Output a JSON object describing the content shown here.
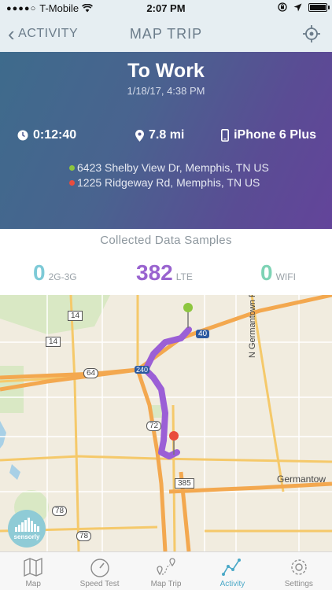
{
  "status_bar": {
    "carrier": "T-Mobile",
    "time": "2:07 PM"
  },
  "nav": {
    "back_label": "ACTIVITY",
    "title": "MAP TRIP"
  },
  "trip": {
    "name": "To Work",
    "date": "1/18/17, 4:38 PM",
    "duration": "0:12:40",
    "distance": "7.8 mi",
    "device": "iPhone 6 Plus",
    "start_address": "6423 Shelby View Dr, Memphis, TN US",
    "end_address": "1225 Ridgeway Rd, Memphis, TN US",
    "start_color": "#8dc63f",
    "end_color": "#e94c3d"
  },
  "samples": {
    "label": "Collected Data Samples",
    "items": [
      {
        "value": "0",
        "unit": "2G-3G",
        "color": "#7dcad7"
      },
      {
        "value": "382",
        "unit": "LTE",
        "color": "#9963cf"
      },
      {
        "value": "0",
        "unit": "WIFI",
        "color": "#7ed3b5"
      }
    ]
  },
  "map": {
    "route_color": "#9b5fd6",
    "street_label": "N Germantown Pkwy",
    "city_label": "Germantow",
    "shields": {
      "us_14_a": "14",
      "us_14_b": "14",
      "us_64": "64",
      "interstate_40": "40",
      "interstate_240": "240",
      "route_72": "72",
      "route_385": "385",
      "route_78_a": "78",
      "route_78_b": "78"
    },
    "logo_text": "sensorly"
  },
  "tabs": [
    {
      "label": "Map",
      "icon": "map-icon"
    },
    {
      "label": "Speed Test",
      "icon": "speedometer-icon"
    },
    {
      "label": "Map Trip",
      "icon": "trip-icon"
    },
    {
      "label": "Activity",
      "icon": "activity-chart-icon",
      "active": true
    },
    {
      "label": "Settings",
      "icon": "gear-icon"
    }
  ]
}
